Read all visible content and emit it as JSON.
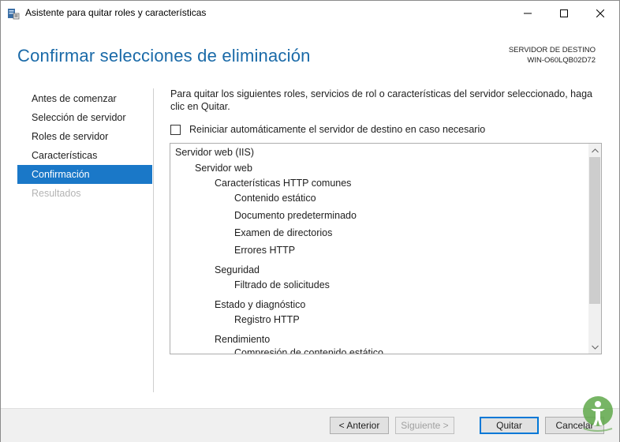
{
  "window": {
    "title": "Asistente para quitar roles y características",
    "icon": "server-manager-icon"
  },
  "header": {
    "title": "Confirmar selecciones de eliminación",
    "destination_label": "SERVIDOR DE DESTINO",
    "destination_server": "WIN-O60LQB02D72"
  },
  "nav": {
    "items": [
      {
        "label": "Antes de comenzar",
        "state": "normal"
      },
      {
        "label": "Selección de servidor",
        "state": "normal"
      },
      {
        "label": "Roles de servidor",
        "state": "normal"
      },
      {
        "label": "Características",
        "state": "normal"
      },
      {
        "label": "Confirmación",
        "state": "active"
      },
      {
        "label": "Resultados",
        "state": "disabled"
      }
    ]
  },
  "main": {
    "intro": "Para quitar los siguientes roles, servicios de rol o características del servidor seleccionado, haga clic en Quitar.",
    "restart_checkbox_label": "Reiniciar automáticamente el servidor de destino en caso necesario",
    "restart_checked": false,
    "tree": [
      {
        "label": "Servidor web (IIS)",
        "level": 0
      },
      {
        "label": "Servidor web",
        "level": 1
      },
      {
        "label": "Características HTTP comunes",
        "level": 2
      },
      {
        "label": "Contenido estático",
        "level": 3
      },
      {
        "label": "Documento predeterminado",
        "level": 3
      },
      {
        "label": "Examen de directorios",
        "level": 3
      },
      {
        "label": "Errores HTTP",
        "level": 3
      },
      {
        "label": "Seguridad",
        "level": 2
      },
      {
        "label": "Filtrado de solicitudes",
        "level": 3
      },
      {
        "label": "Estado y diagnóstico",
        "level": 2
      },
      {
        "label": "Registro HTTP",
        "level": 3
      },
      {
        "label": "Rendimiento",
        "level": 2
      },
      {
        "label": "Compresión de contenido estático",
        "level": 3
      }
    ]
  },
  "footer": {
    "prev_label": "< Anterior",
    "next_label": "Siguiente >",
    "remove_label": "Quitar",
    "cancel_label": "Cancelar"
  },
  "colors": {
    "accent": "#1a78c8",
    "title": "#1a6aa8"
  }
}
